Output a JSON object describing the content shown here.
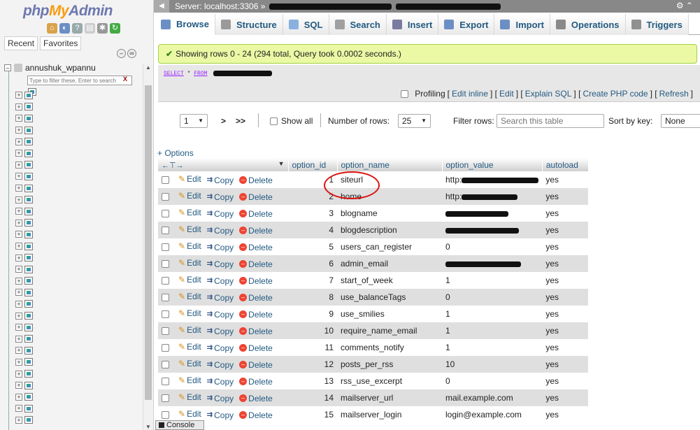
{
  "nav": {
    "logo_php": "php",
    "logo_my": "My",
    "logo_admin": "Admin",
    "tabs": [
      "Recent",
      "Favorites"
    ],
    "db_name": "annushuk_wpannu",
    "filter_placeholder": "Type to filter these, Enter to search",
    "filter_clear": "X",
    "table_count": 29
  },
  "topbar": {
    "server": "Server: localhost:3306 »"
  },
  "tabs": [
    {
      "label": "Browse",
      "icon": "browse-icon",
      "color": "#6b8fc4"
    },
    {
      "label": "Structure",
      "icon": "structure-icon",
      "color": "#9a9a9a"
    },
    {
      "label": "SQL",
      "icon": "sql-icon",
      "color": "#8ab0e0"
    },
    {
      "label": "Search",
      "icon": "search-icon",
      "color": "#a0a0a0"
    },
    {
      "label": "Insert",
      "icon": "insert-icon",
      "color": "#7a7aa0"
    },
    {
      "label": "Export",
      "icon": "export-icon",
      "color": "#6b8fc4"
    },
    {
      "label": "Import",
      "icon": "import-icon",
      "color": "#6b8fc4"
    },
    {
      "label": "Operations",
      "icon": "wrench-icon",
      "color": "#8a8a8a"
    },
    {
      "label": "Triggers",
      "icon": "triggers-icon",
      "color": "#909090"
    }
  ],
  "message": {
    "success": "Showing rows 0 - 24 (294 total, Query took 0.0002 seconds.)"
  },
  "sql": {
    "select": "SELECT",
    "star": "*",
    "from": "FROM"
  },
  "profiling": {
    "label": "Profiling",
    "links": [
      "Edit inline",
      "Edit",
      "Explain SQL",
      "Create PHP code",
      "Refresh"
    ]
  },
  "pager": {
    "page": "1",
    "next": ">",
    "last": ">>",
    "show_all": "Show all",
    "rows_label": "Number of rows:",
    "rows_value": "25",
    "filter_label": "Filter rows:",
    "filter_placeholder": "Search this table",
    "sort_label": "Sort by key:",
    "sort_value": "None"
  },
  "table": {
    "options_link": "+ Options",
    "columns": [
      "option_id",
      "option_name",
      "option_value",
      "autoload"
    ],
    "actions": {
      "edit": "Edit",
      "copy": "Copy",
      "delete": "Delete"
    },
    "rows": [
      {
        "id": "1",
        "name": "siteurl",
        "value_prefix": "http:",
        "redacted": 110,
        "autoload": "yes"
      },
      {
        "id": "2",
        "name": "home",
        "value_prefix": "http:",
        "redacted": 80,
        "autoload": "yes"
      },
      {
        "id": "3",
        "name": "blogname",
        "value_prefix": "",
        "redacted": 90,
        "autoload": "yes"
      },
      {
        "id": "4",
        "name": "blogdescription",
        "value_prefix": "",
        "redacted": 105,
        "autoload": "yes"
      },
      {
        "id": "5",
        "name": "users_can_register",
        "value_prefix": "0",
        "redacted": 0,
        "autoload": "yes"
      },
      {
        "id": "6",
        "name": "admin_email",
        "value_prefix": "",
        "redacted": 108,
        "autoload": "yes"
      },
      {
        "id": "7",
        "name": "start_of_week",
        "value_prefix": "1",
        "redacted": 0,
        "autoload": "yes"
      },
      {
        "id": "8",
        "name": "use_balanceTags",
        "value_prefix": "0",
        "redacted": 0,
        "autoload": "yes"
      },
      {
        "id": "9",
        "name": "use_smilies",
        "value_prefix": "1",
        "redacted": 0,
        "autoload": "yes"
      },
      {
        "id": "10",
        "name": "require_name_email",
        "value_prefix": "1",
        "redacted": 0,
        "autoload": "yes"
      },
      {
        "id": "11",
        "name": "comments_notify",
        "value_prefix": "1",
        "redacted": 0,
        "autoload": "yes"
      },
      {
        "id": "12",
        "name": "posts_per_rss",
        "value_prefix": "10",
        "redacted": 0,
        "autoload": "yes"
      },
      {
        "id": "13",
        "name": "rss_use_excerpt",
        "value_prefix": "0",
        "redacted": 0,
        "autoload": "yes"
      },
      {
        "id": "14",
        "name": "mailserver_url",
        "value_prefix": "mail.example.com",
        "redacted": 0,
        "autoload": "yes"
      },
      {
        "id": "15",
        "name": "mailserver_login",
        "value_prefix": "login@example.com",
        "redacted": 0,
        "autoload": "yes"
      }
    ]
  },
  "console": {
    "label": "Console"
  }
}
